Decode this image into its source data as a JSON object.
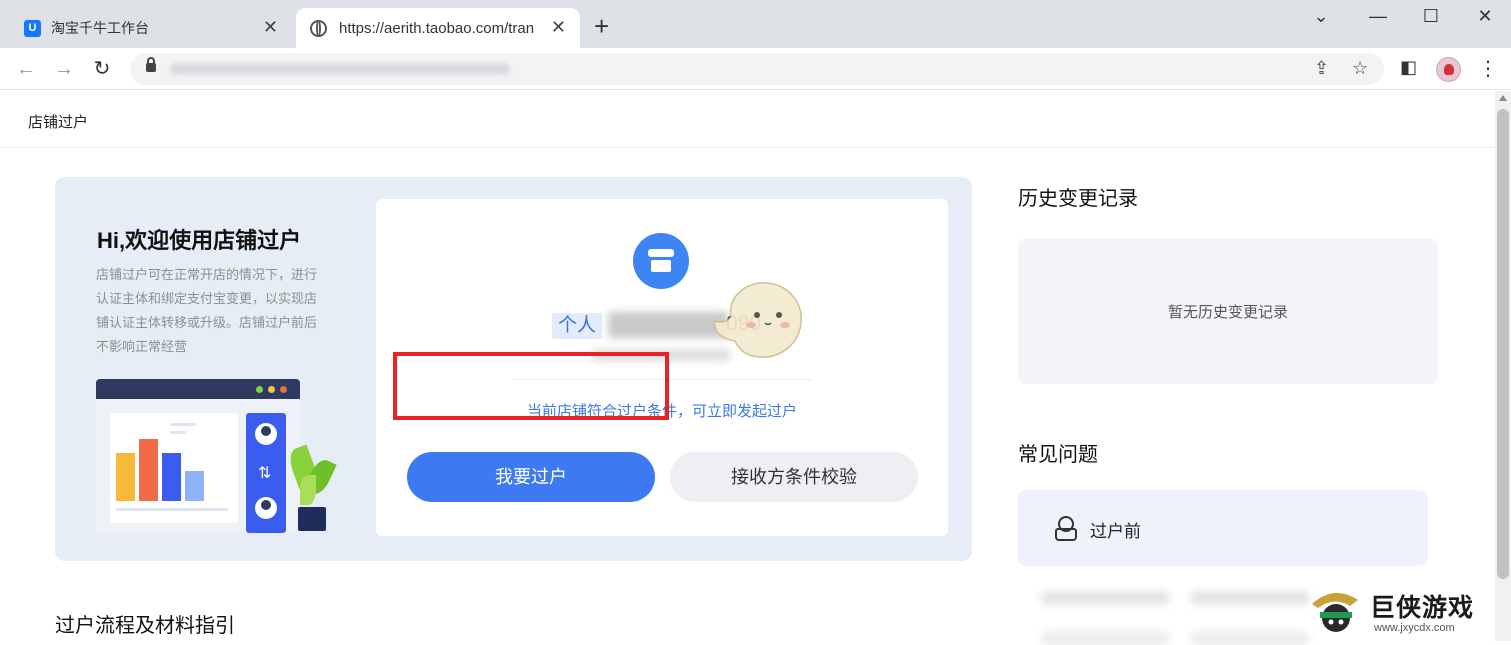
{
  "browser": {
    "tabs": [
      {
        "title": "淘宝千牛工作台",
        "icon": "qianniu-icon"
      },
      {
        "title": "https://aerith.taobao.com/tran",
        "icon": "globe-icon",
        "active": true
      }
    ],
    "new_tab": "+",
    "window_controls": {
      "dropdown": "⌄",
      "minimize": "—",
      "maximize": "☐",
      "close": "✕"
    },
    "nav": {
      "back": "←",
      "forward": "→",
      "reload": "↻"
    }
  },
  "page": {
    "breadcrumb": "店铺过户",
    "hero": {
      "title": "Hi,欢迎使用店铺过户",
      "description": "店铺过户可在正常开店的情况下，进行认证主体和绑定支付宝变更，以实现店铺认证主体转移或升级。店铺过户前后不影响正常经营"
    },
    "shop_card": {
      "account_type": "个人",
      "account_suffix": "090",
      "eligibility": "当前店铺符合过户条件，可立即发起过户",
      "primary_button": "我要过户",
      "secondary_button": "接收方条件校验"
    },
    "history": {
      "title": "历史变更记录",
      "empty_text": "暂无历史变更记录"
    },
    "faq": {
      "title": "常见问题",
      "items": [
        {
          "label": "过户前"
        }
      ]
    },
    "process_section_title": "过户流程及材料指引"
  },
  "watermark": {
    "name": "巨侠游戏",
    "url": "www.jxycdx.com"
  },
  "colors": {
    "accent": "#3d7af2",
    "highlight_border": "#e82323",
    "hero_bg": "#e6edf7"
  }
}
